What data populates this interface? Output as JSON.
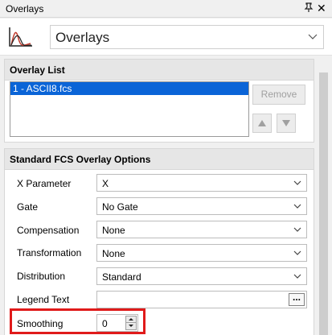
{
  "window": {
    "title": "Overlays",
    "pin_glyph": "ᵩ",
    "close_glyph": "✕"
  },
  "header": {
    "icon": "overlay-curves-icon",
    "combo_value": "Overlays"
  },
  "overlay_list": {
    "heading": "Overlay List",
    "items": [
      "1 - ASCII8.fcs"
    ],
    "remove_label": "Remove",
    "up_icon": "triangle-up-icon",
    "down_icon": "triangle-down-icon"
  },
  "options": {
    "heading": "Standard FCS Overlay Options",
    "x_parameter": {
      "label": "X Parameter",
      "value": "X"
    },
    "gate": {
      "label": "Gate",
      "value": "No Gate"
    },
    "compensation": {
      "label": "Compensation",
      "value": "None"
    },
    "transformation": {
      "label": "Transformation",
      "value": "None"
    },
    "distribution": {
      "label": "Distribution",
      "value": "Standard"
    },
    "legend_text": {
      "label": "Legend Text",
      "value": "",
      "button": "..."
    },
    "smoothing": {
      "label": "Smoothing",
      "value": "0"
    }
  },
  "colors": {
    "selection": "#0a64d7",
    "highlight_box": "#e01a1a"
  }
}
